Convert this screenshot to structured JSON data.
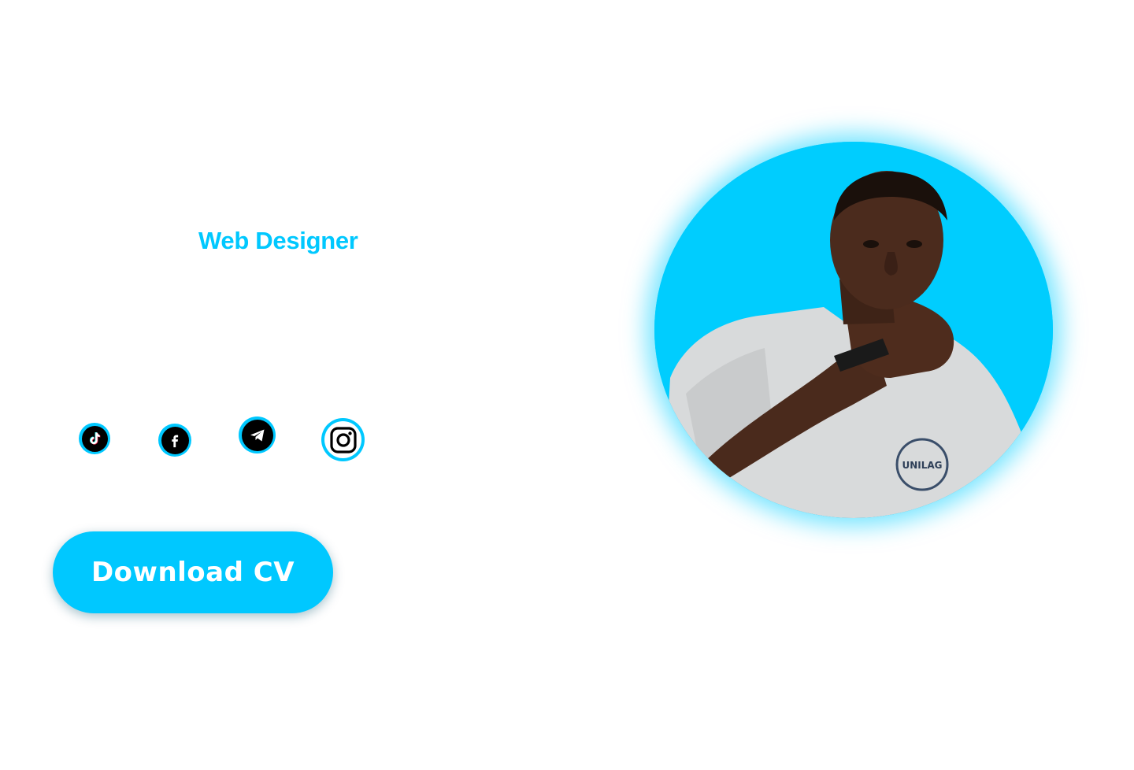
{
  "hero": {
    "role": "Web Designer",
    "download_button_label": "Download CV"
  },
  "social_links": [
    {
      "name": "tiktok",
      "icon": "tiktok-icon"
    },
    {
      "name": "facebook",
      "icon": "facebook-icon"
    },
    {
      "name": "telegram",
      "icon": "telegram-icon"
    },
    {
      "name": "instagram",
      "icon": "instagram-icon"
    }
  ],
  "portrait": {
    "alt": "profile-photo"
  },
  "colors": {
    "accent": "#00c8ff",
    "portrait_bg": "#00cdfe",
    "background": "#ffffff",
    "icon_bg": "#000000"
  }
}
